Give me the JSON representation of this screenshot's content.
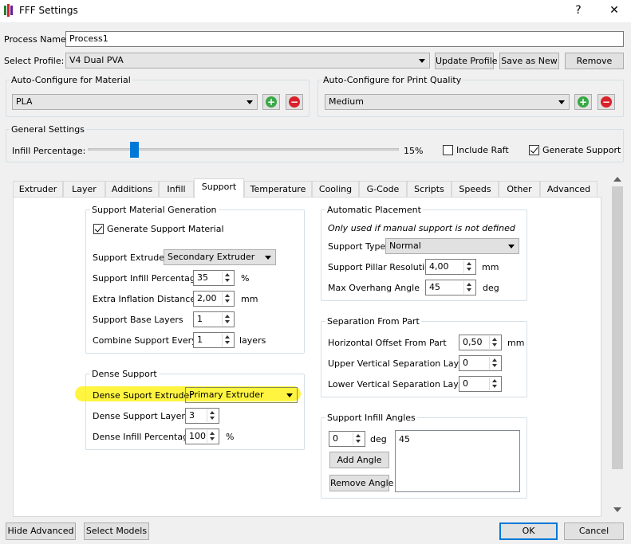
{
  "window": {
    "title": "FFF Settings",
    "help_glyph": "?",
    "close_glyph": "✕",
    "icon": "app-logo-icon"
  },
  "process": {
    "label": "Process Name:",
    "value": "Process1"
  },
  "profile": {
    "label": "Select Profile:",
    "value": "V4 Dual PVA",
    "update_label": "Update Profile",
    "save_label": "Save as New",
    "remove_label": "Remove"
  },
  "material": {
    "title": "Auto-Configure for Material",
    "value": "PLA"
  },
  "quality": {
    "title": "Auto-Configure for Print Quality",
    "value": "Medium"
  },
  "general": {
    "title": "General Settings",
    "infill_label": "Infill Percentage:",
    "infill_value": "15%",
    "infill_fraction": 0.15,
    "raft_label": "Include Raft",
    "raft_checked": false,
    "support_label": "Generate Support",
    "support_checked": true
  },
  "tabs": [
    "Extruder",
    "Layer",
    "Additions",
    "Infill",
    "Support",
    "Temperature",
    "Cooling",
    "G-Code",
    "Scripts",
    "Speeds",
    "Other",
    "Advanced"
  ],
  "active_tab": "Support",
  "smg": {
    "title": "Support Material Generation",
    "generate_label": "Generate Support Material",
    "extruder_label": "Support Extruder",
    "extruder_value": "Secondary Extruder",
    "infill_label": "Support Infill Percentage",
    "infill_value": "35",
    "infill_unit": "%",
    "inflation_label": "Extra Inflation Distance",
    "inflation_value": "2,00",
    "inflation_unit": "mm",
    "base_label": "Support Base Layers",
    "base_value": "1",
    "combine_label": "Combine Support Every",
    "combine_value": "1",
    "combine_unit": "layers"
  },
  "dense": {
    "title": "Dense Support",
    "extruder_label": "Dense Suport Extruder",
    "extruder_value": "Primary Extruder",
    "layers_label": "Dense Support Layers",
    "layers_value": "3",
    "infill_label": "Dense Infill Percentage",
    "infill_value": "100",
    "infill_unit": "%"
  },
  "auto": {
    "title": "Automatic Placement",
    "note": "Only used if manual support is not defined",
    "type_label": "Support Type",
    "type_value": "Normal",
    "pillar_label": "Support Pillar Resolution",
    "pillar_value": "4,00",
    "pillar_unit": "mm",
    "overhang_label": "Max Overhang Angle",
    "overhang_value": "45",
    "overhang_unit": "deg"
  },
  "sep": {
    "title": "Separation From Part",
    "horiz_label": "Horizontal Offset From Part",
    "horiz_value": "0,50",
    "horiz_unit": "mm",
    "upper_label": "Upper Vertical Separation Layers",
    "upper_value": "0",
    "lower_label": "Lower Vertical Separation Layers",
    "lower_value": "0"
  },
  "angles": {
    "title": "Support Infill Angles",
    "angle_value": "0",
    "angle_unit": "deg",
    "add_label": "Add Angle",
    "remove_label": "Remove Angle",
    "list": "45"
  },
  "footer": {
    "hide_label": "Hide Advanced",
    "select_label": "Select Models",
    "ok_label": "OK",
    "cancel_label": "Cancel"
  }
}
